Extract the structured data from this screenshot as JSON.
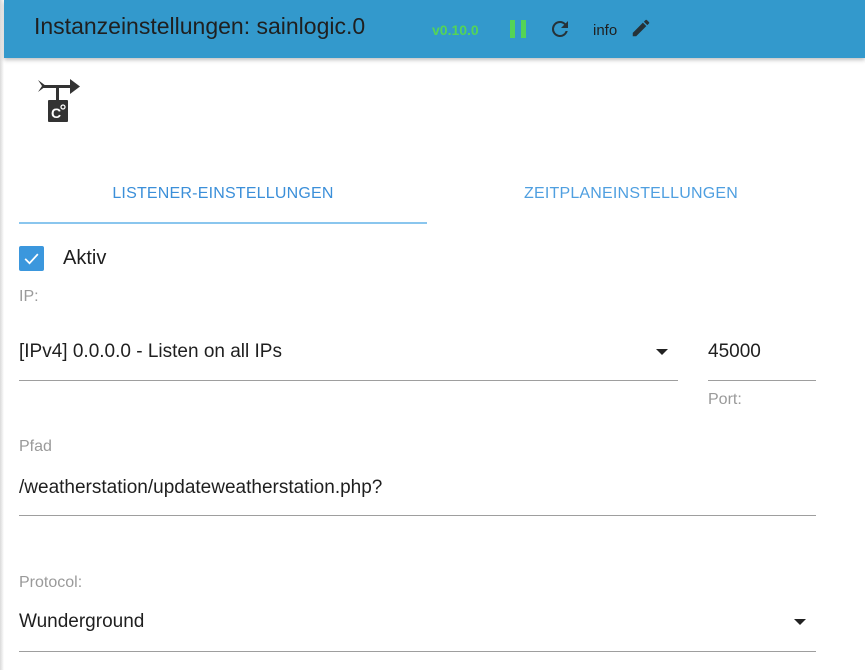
{
  "header": {
    "title": "Instanzeinstellungen: sainlogic.0",
    "version": "v0.10.0",
    "info_label": "info",
    "accent_color": "#3399cc",
    "icons": [
      "pause-icon",
      "reload-icon",
      "edit-icon"
    ]
  },
  "adapter": {
    "logo_icon": "weather-vane-celsius-icon"
  },
  "tabs": [
    {
      "label": "LISTENER-EINSTELLUNGEN",
      "active": true
    },
    {
      "label": "ZEITPLANEINSTELLUNGEN",
      "active": false
    }
  ],
  "form": {
    "active": {
      "label": "Aktiv",
      "checked": true
    },
    "ip": {
      "label": "IP:",
      "value": "[IPv4] 0.0.0.0 - Listen on all IPs"
    },
    "port": {
      "label": "Port:",
      "value": "45000"
    },
    "path": {
      "label": "Pfad",
      "value": "/weatherstation/updateweatherstation.php?"
    },
    "protocol": {
      "label": "Protocol:",
      "value": "Wunderground"
    }
  }
}
